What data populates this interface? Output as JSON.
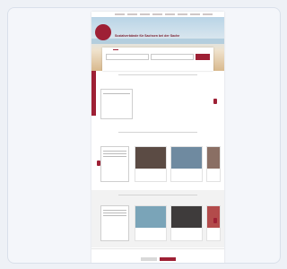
{
  "page": {
    "site_title": "Sozialverbände für Sachsen bei der Sache",
    "site_subtitle": "",
    "logo_text": "",
    "nav_items": [
      "",
      "",
      "",
      "",
      "",
      "",
      "",
      "",
      ""
    ]
  },
  "search": {
    "tabs": [
      "",
      "",
      ""
    ],
    "active_tab_index": 1,
    "field_placeholder_1": "",
    "field_placeholder_2": "",
    "button_label": "",
    "link_text": ""
  },
  "section1": {
    "title": "",
    "subtitle": "",
    "infobox_title": "",
    "infobox_text": [
      "",
      "",
      ""
    ],
    "more_link": ""
  },
  "section2": {
    "title": "",
    "subtitle": "",
    "infobox_title": "",
    "tiles": [
      {
        "caption": "",
        "color": "#5b4b44"
      },
      {
        "caption": "",
        "color": "#6f8aa0"
      }
    ],
    "more_link": ""
  },
  "section3": {
    "title": "",
    "infobox_title": "",
    "tiles": [
      {
        "caption": "",
        "color": "#7aa4b8"
      },
      {
        "caption": "",
        "color": "#3e3b3b"
      }
    ],
    "more_link": ""
  },
  "footer": {
    "title": "",
    "text": "",
    "buttons": [
      "",
      ""
    ]
  },
  "colors": {
    "accent": "#9e2035",
    "background": "#eef1f6"
  }
}
